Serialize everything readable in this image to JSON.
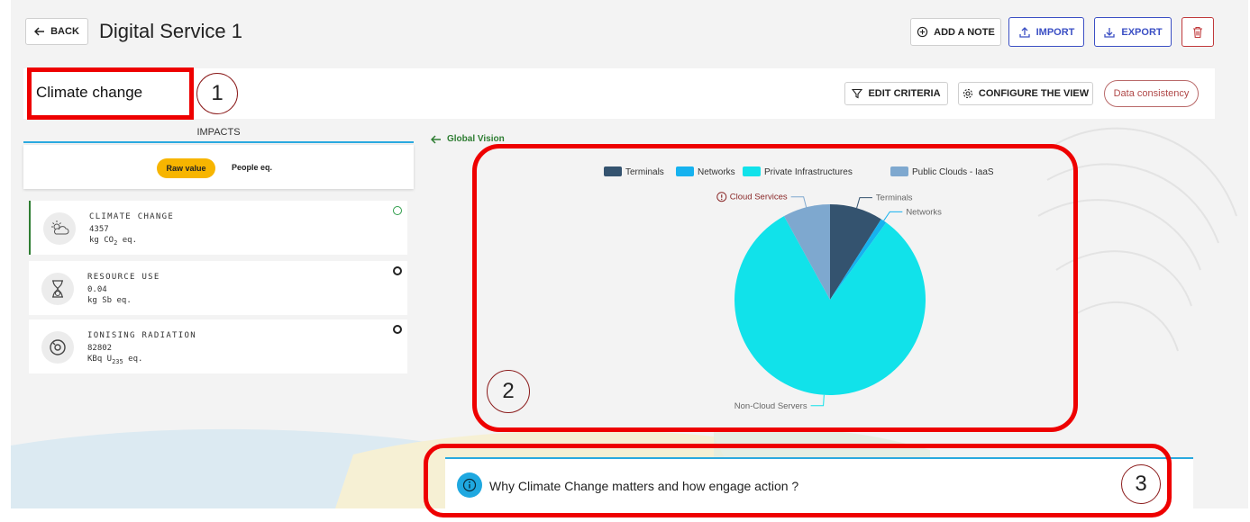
{
  "header": {
    "back_label": "BACK",
    "title": "Digital Service 1",
    "add_note_label": "ADD A NOTE",
    "import_label": "IMPORT",
    "export_label": "EXPORT",
    "delete_icon": "trash-icon"
  },
  "criteria_bar": {
    "title": "Climate change",
    "edit_label": "EDIT CRITERIA",
    "configure_label": "CONFIGURE THE VIEW",
    "consistency_label": "Data consistency"
  },
  "impacts": {
    "label": "IMPACTS",
    "raw_value_label": "Raw value",
    "people_eq_label": "People eq.",
    "cards": [
      {
        "name": "CLIMATE CHANGE",
        "value": "4357",
        "unit_prefix": "kg CO",
        "unit_sub": "2",
        "unit_suffix": " eq.",
        "icon": "climate-icon",
        "active": true
      },
      {
        "name": "RESOURCE USE",
        "value": "0.04",
        "unit_prefix": "kg Sb eq.",
        "unit_sub": "",
        "unit_suffix": "",
        "icon": "hourglass-icon",
        "active": false
      },
      {
        "name": "IONISING RADIATION",
        "value": "82802",
        "unit_prefix": "KBq U",
        "unit_sub": "235",
        "unit_suffix": " eq.",
        "icon": "radiation-icon",
        "active": false
      }
    ]
  },
  "global_vision_label": "Global Vision",
  "chart_data": {
    "type": "pie",
    "legend": [
      "Terminals",
      "Networks",
      "Private Infrastructures",
      "Public Clouds - IaaS"
    ],
    "legend_colors": [
      "#34536f",
      "#16b2ef",
      "#11e2ea",
      "#7ea8cf"
    ],
    "slices": [
      {
        "label": "Terminals",
        "percent": 9.0,
        "color": "#34536f"
      },
      {
        "label": "Networks",
        "percent": 1.0,
        "color": "#16b2ef"
      },
      {
        "label": "Non-Cloud Servers",
        "percent": 82.0,
        "color": "#11e2ea"
      },
      {
        "label": "Cloud Services",
        "percent": 8.0,
        "color": "#7ea8cf"
      }
    ],
    "warning_slice": "Cloud Services",
    "legend_position": "top"
  },
  "info": {
    "text": "Why Climate Change matters and how engage action ?"
  },
  "annotations": {
    "one": "1",
    "two": "2",
    "three": "3"
  },
  "colors": {
    "accent_blue": "#3b4fc4",
    "danger": "#c0393b",
    "cyan_line": "#2aa9df",
    "highlight": "#f7b500",
    "success": "#2e7d32"
  }
}
